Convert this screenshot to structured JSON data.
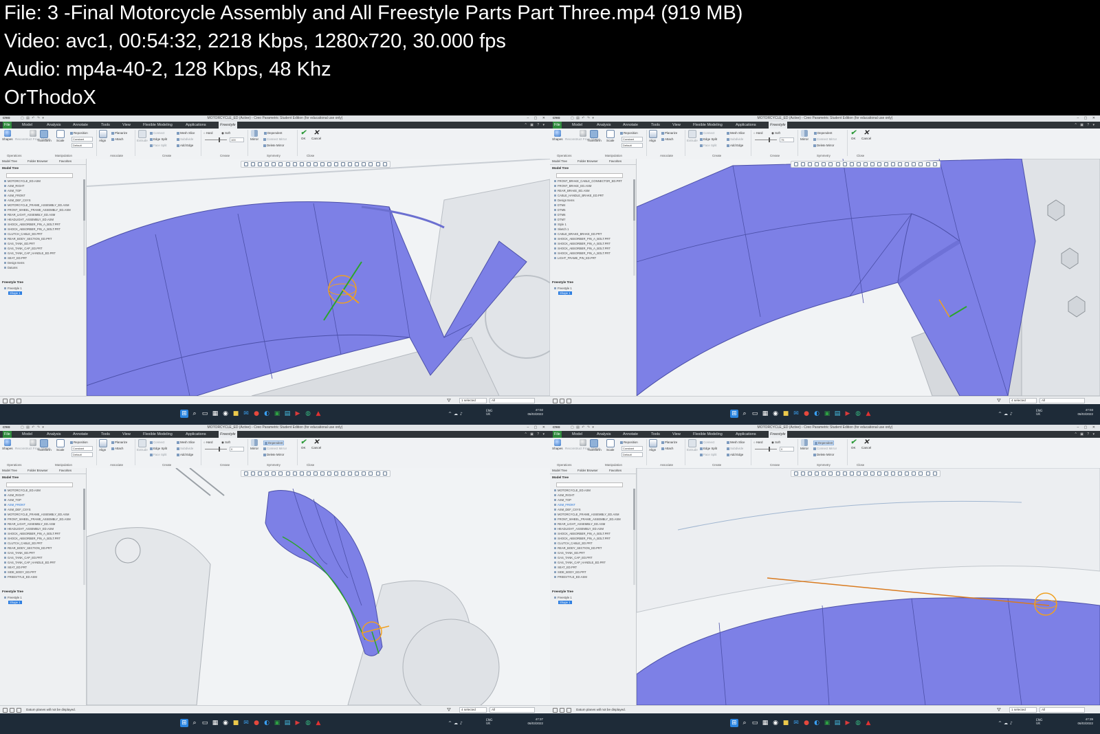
{
  "header": {
    "lines": [
      "File: 3 -Final Motorcycle Assembly and All Freestyle Parts Part Three.mp4 (919 MB)",
      "Video: avc1, 00:54:32, 2218 Kbps, 1280x720, 30.000 fps",
      "Audio: mp4a-40-2, 128 Kbps, 48 Khz",
      "OrThodoX"
    ]
  },
  "app": {
    "logo": "creo",
    "window_title": "MOTORCYCLE_ED (Active) - Creo Parametric Student Edition (for educational use only)",
    "tabs": [
      "File",
      "Model",
      "Analysis",
      "Annotate",
      "Tools",
      "View",
      "Flexible Modeling",
      "Applications",
      "Freestyle"
    ],
    "active_tab": "Freestyle",
    "ribbon": {
      "shapes": "Shapes",
      "reconstruct": "Reconstruct From Shape",
      "transform": "Transform",
      "scale": "Scale",
      "align": "Align",
      "reposition": "Reposition",
      "constant": "Constant",
      "default": "Default",
      "planarize": "Planarize",
      "attach": "Attach",
      "extrude": "Extrude",
      "connect": "Connect",
      "edge_split": "Edge Split",
      "face_split": "Face Split",
      "mesh_slice": "Mesh Slice",
      "subdivide": "Subdivide",
      "add_edge": "Add Edge",
      "hard": "Hard",
      "soft": "Soft",
      "mirror": "Mirror",
      "dependent": "Dependent",
      "connect_mirror": "Connect Mirror",
      "delete_mirror": "Delete Mirror",
      "ok": "OK",
      "cancel": "Cancel",
      "groups": [
        "Operations",
        "Manipulation",
        "Associate",
        "Create",
        "Crease",
        "Symmetry",
        "Close"
      ]
    },
    "sidebar": {
      "tabs": [
        "Model Tree",
        "Folder Browser",
        "Favorites"
      ],
      "model_tree": "Model Tree",
      "freestyle_tree": "Freestyle Tree",
      "freestyle_items": [
        "Freestyle 1",
        "Shape 1"
      ]
    },
    "taskbar": {
      "lang": "ENG",
      "region": "UK"
    }
  },
  "panels": [
    {
      "crease_value": "100",
      "tree": [
        "MOTORCYCLE_ED.ASM",
        "ASM_RIGHT",
        "ASM_TOP",
        "ASM_FRONT",
        "ASM_DEF_CSYS",
        "MOTORCYCLE_FRAME_ASSEMBLY_ED.ASM",
        "FRONT_WHEEL_FRAME_ASSEMBLY_ED.ASM",
        "REAR_LIGHT_ASSEMBLY_ED.ASM",
        "HEADLIGHT_ASSEMBLY_ED.ASM",
        "SHOCK_ABSORBER_PIN_A_BOLT.PRT",
        "SHOCK_ABSORBER_PIN_A_BOLT.PRT",
        "CLUTCH_CABLE_ED.PRT",
        "REAR_BODY_SECTION_ED.PRT",
        "GAS_TANK_ED.PRT",
        "GAS_TANK_CAP_ED.PRT",
        "GAS_TANK_CAP_HANDLE_ED.PRT",
        "SEAT_ED.PRT",
        "Design Items",
        "Datums"
      ],
      "highlighted_index": -1,
      "status_message": "",
      "selected": "1 selected",
      "filter": "All",
      "time": "47:02",
      "date": "06/03/2022"
    },
    {
      "crease_value": "75",
      "tree": [
        "FRONT_BRAKE_CABLE_CONNECTOR_ED.PRT",
        "FRONT_BRAKE_ED.ASM",
        "REAR_BRAKE_ED.ASM",
        "CABLE_HANDLE_BRAKE_ED.PRT",
        "Design Items",
        "DTM4",
        "DTM5",
        "DTM6",
        "DTM7",
        "Style 1",
        "Sketch 1",
        "CABLE_BRAKE_BRAKE_ED.PRT",
        "SHOCK_ABSORBER_PIN_A_BOLT.PRT",
        "SHOCK_ABSORBER_PIN_A_BOLT.PRT",
        "SHOCK_ABSORBER_PIN_A_BOLT.PRT",
        "SHOCK_ABSORBER_PIN_A_BOLT.PRT",
        "LIGHT_FRAME_PIN_ED.PRT"
      ],
      "highlighted_index": -1,
      "status_message": "",
      "selected": "4 selected",
      "filter": "All",
      "time": "47:03",
      "date": "06/03/2022"
    },
    {
      "crease_value": "0",
      "tree": [
        "MOTORCYCLE_ED.ASM",
        "ASM_RIGHT",
        "ASM_TOP",
        "ASM_FRONT",
        "ASM_DEF_CSYS",
        "MOTORCYCLE_FRAME_ASSEMBLY_ED.ASM",
        "FRONT_WHEEL_FRAME_ASSEMBLY_ED.ASM",
        "REAR_LIGHT_ASSEMBLY_ED.ASM",
        "HEADLIGHT_ASSEMBLY_ED.ASM",
        "SHOCK_ABSORBER_PIN_A_BOLT.PRT",
        "SHOCK_ABSORBER_PIN_A_BOLT.PRT",
        "CLUTCH_CABLE_ED.PRT",
        "REAR_BODY_SECTION_ED.PRT",
        "GAS_TANK_ED.PRT",
        "GAS_TANK_CAP_ED.PRT",
        "GAS_TANK_CAP_HANDLE_ED.PRT",
        "SEAT_ED.PRT",
        "SIDE_BODY_ED.PRT",
        "FREESTYLE_ED.ASM"
      ],
      "highlighted_index": 3,
      "status_message": "Datum planes will not be displayed.",
      "selected": "4 selected",
      "filter": "All",
      "time": "47:37",
      "date": "06/03/2022"
    },
    {
      "crease_value": "0",
      "tree": [
        "MOTORCYCLE_ED.ASM",
        "ASM_RIGHT",
        "ASM_TOP",
        "ASM_FRONT",
        "ASM_DEF_CSYS",
        "MOTORCYCLE_FRAME_ASSEMBLY_ED.ASM",
        "FRONT_WHEEL_FRAME_ASSEMBLY_ED.ASM",
        "REAR_LIGHT_ASSEMBLY_ED.ASM",
        "HEADLIGHT_ASSEMBLY_ED.ASM",
        "SHOCK_ABSORBER_PIN_A_BOLT.PRT",
        "SHOCK_ABSORBER_PIN_A_BOLT.PRT",
        "CLUTCH_CABLE_ED.PRT",
        "REAR_BODY_SECTION_ED.PRT",
        "GAS_TANK_ED.PRT",
        "GAS_TANK_CAP_ED.PRT",
        "GAS_TANK_CAP_HANDLE_ED.PRT",
        "SEAT_ED.PRT",
        "SIDE_BODY_ED.PRT",
        "FREESTYLE_ED.ASM"
      ],
      "highlighted_index": 3,
      "status_message": "Datum planes will not be displayed.",
      "selected": "1 selected",
      "filter": "All",
      "time": "47:39",
      "date": "06/03/2022"
    }
  ],
  "colors": {
    "surface": "#7d80e6",
    "surface_dark": "#5f62c8",
    "ribbon_file_tab": "#2f8a3c",
    "taskbar": "#1e2b38",
    "selection": "#2c7de0",
    "dragger_orange": "#f0a020",
    "dragger_green": "#2aa52a"
  }
}
